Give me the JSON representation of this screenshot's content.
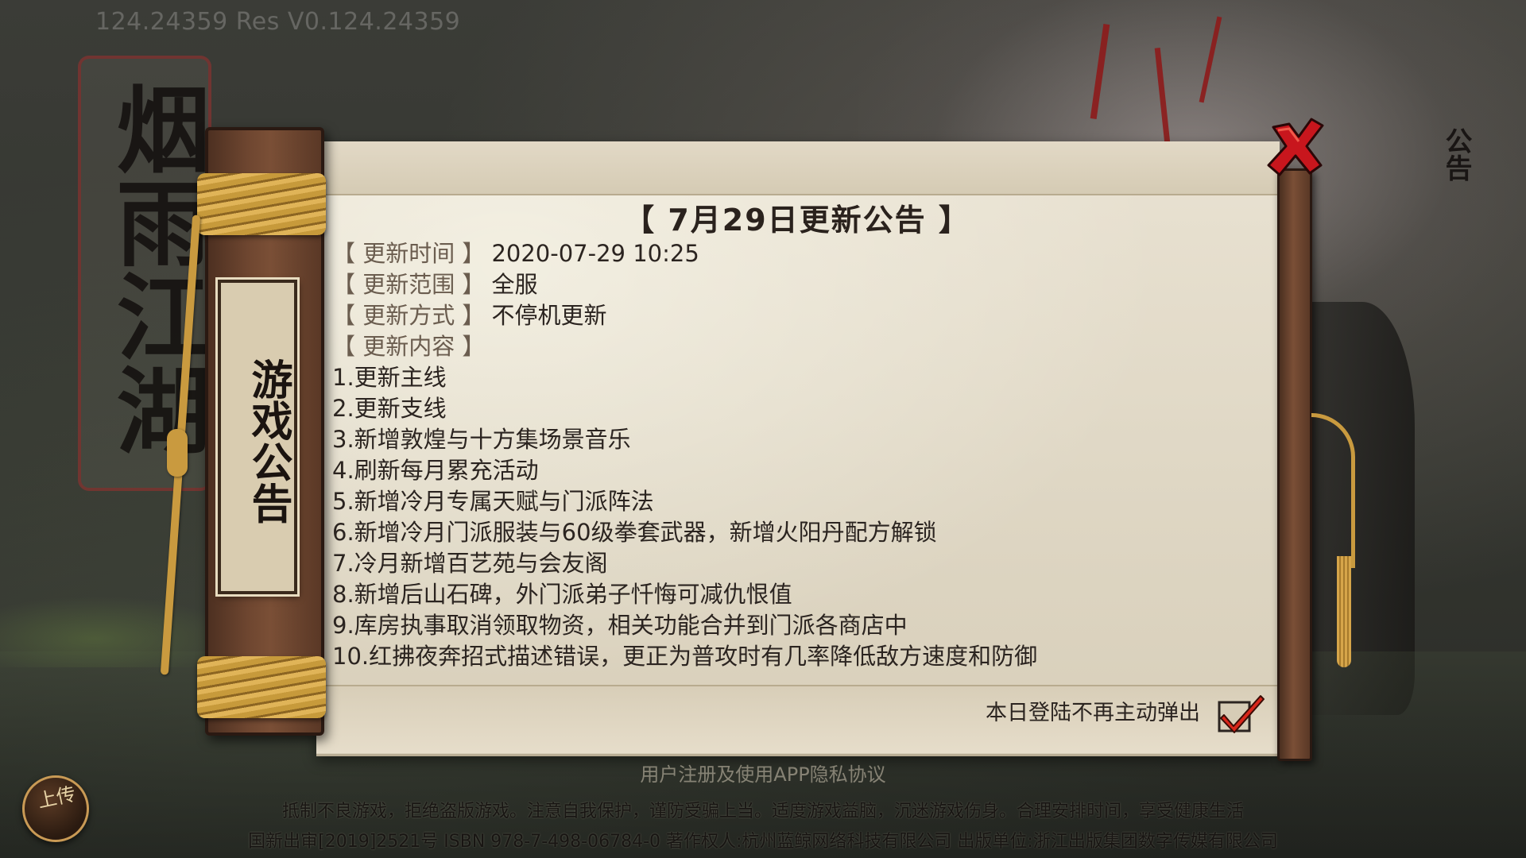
{
  "version": "124.24359  Res V0.124.24359",
  "logo": {
    "title": "烟雨江湖"
  },
  "board": {
    "label": "游戏公告"
  },
  "side_button": {
    "label": "公告"
  },
  "notice": {
    "title": "【 7月29日更新公告 】",
    "meta": [
      {
        "label": "【 更新时间 】",
        "value": "2020-07-29 10:25"
      },
      {
        "label": "【 更新范围 】",
        "value": "全服"
      },
      {
        "label": "【 更新方式 】",
        "value": "不停机更新"
      },
      {
        "label": "【 更新内容 】",
        "value": ""
      }
    ],
    "items": [
      "1.更新主线",
      "2.更新支线",
      "3.新增敦煌与十方集场景音乐",
      "4.刷新每月累充活动",
      "5.新增冷月专属天赋与门派阵法",
      "6.新增冷月门派服装与60级拳套武器，新增火阳丹配方解锁",
      "7.冷月新增百艺苑与会友阁",
      "8.新增后山石碑，外门派弟子忏悔可减仇恨值",
      "9.库房执事取消领取物资，相关功能合并到门派各商店中",
      "10.红拂夜奔招式描述错误，更正为普攻时有几率降低敌方速度和防御"
    ]
  },
  "no_popup": {
    "label": "本日登陆不再主动弹出",
    "checked": true
  },
  "share_button": {
    "label": "上传"
  },
  "footer": {
    "privacy": "用户注册及使用APP隐私协议",
    "health": "抵制不良游戏，拒绝盗版游戏。注意自我保护，谨防受骗上当。适度游戏益脑，沉迷游戏伤身。合理安排时间，享受健康生活",
    "isbn": "国新出审[2019]2521号 ISBN 978-7-498-06784-0 著作权人:杭州蓝鲸网络科技有限公司 出版单位:浙江出版集团数字传媒有限公司"
  },
  "colors": {
    "close_red": "#c8161d",
    "check_red": "#d8261a",
    "wood": "#6e4630",
    "paper": "#e6dfcf"
  }
}
